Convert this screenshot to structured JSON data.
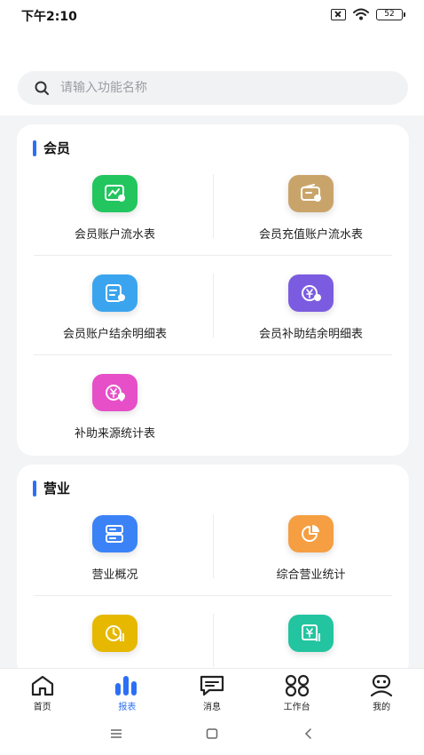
{
  "status_bar": {
    "time": "下午2:10",
    "battery": "52"
  },
  "search": {
    "placeholder": "请输入功能名称"
  },
  "sections": [
    {
      "title": "会员",
      "items": [
        {
          "label": "会员账户流水表",
          "icon": "account-flow-icon",
          "color": "#22c55e"
        },
        {
          "label": "会员充值账户流水表",
          "icon": "recharge-wallet-icon",
          "color": "#c9a46a"
        },
        {
          "label": "会员账户结余明细表",
          "icon": "balance-detail-icon",
          "color": "#3ba4ee"
        },
        {
          "label": "会员补助结余明细表",
          "icon": "subsidy-balance-icon",
          "color": "#7b5ce0"
        },
        {
          "label": "补助来源统计表",
          "icon": "subsidy-source-icon",
          "color": "#e64fc8"
        }
      ]
    },
    {
      "title": "营业",
      "items": [
        {
          "label": "营业概况",
          "icon": "business-overview-icon",
          "color": "#3b82f6"
        },
        {
          "label": "综合营业统计",
          "icon": "pie-chart-icon",
          "color": "#f59e42"
        },
        {
          "label": "",
          "icon": "time-stats-icon",
          "color": "#e6b800"
        },
        {
          "label": "",
          "icon": "currency-stats-icon",
          "color": "#23c4a0"
        }
      ]
    }
  ],
  "tabs": [
    {
      "label": "首页",
      "icon": "home-icon"
    },
    {
      "label": "报表",
      "icon": "bar-chart-icon",
      "active": true
    },
    {
      "label": "消息",
      "icon": "message-icon"
    },
    {
      "label": "工作台",
      "icon": "workbench-grid-icon"
    },
    {
      "label": "我的",
      "icon": "profile-icon"
    }
  ]
}
